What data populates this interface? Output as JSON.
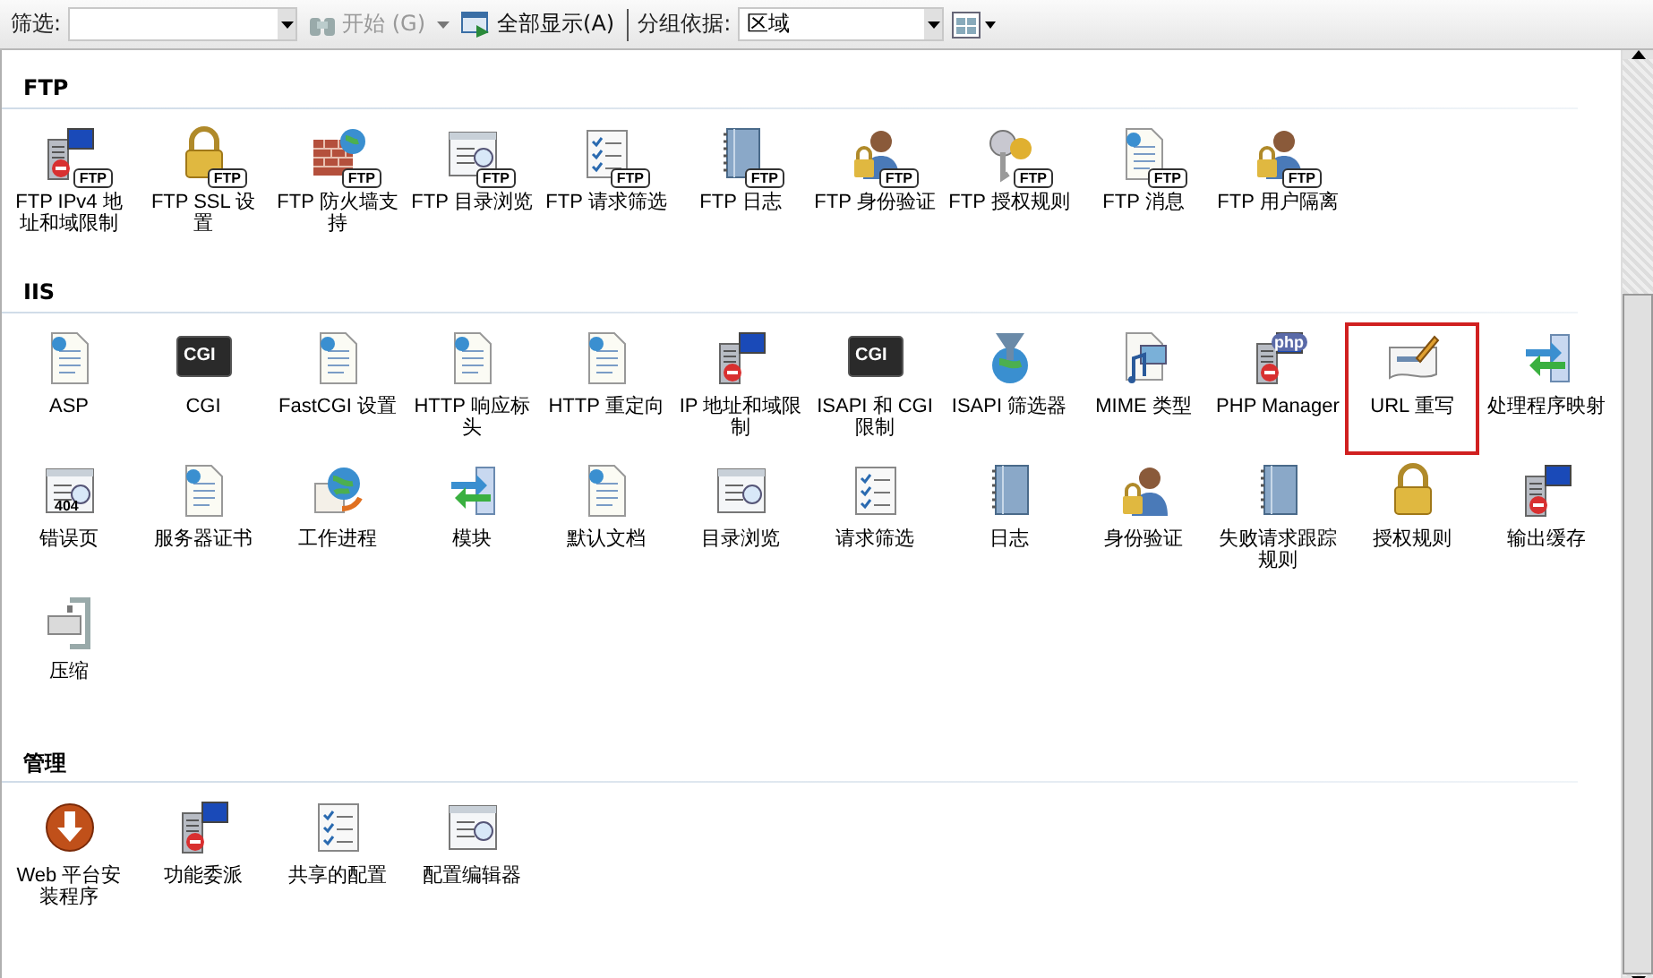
{
  "toolbar": {
    "filter_label": "筛选:",
    "start_button": {
      "label": "开始 (G)",
      "disabled": true
    },
    "show_all_button": {
      "label": "全部显示(A)",
      "disabled": false
    },
    "group_label": "分组依据:",
    "group_value": "区域"
  },
  "sections": [
    {
      "title": "FTP",
      "tiles": [
        {
          "label": "FTP IPv4 地址和域限制",
          "badge": "FTP",
          "selected": false
        },
        {
          "label": "FTP SSL 设置",
          "badge": "FTP",
          "selected": false
        },
        {
          "label": "FTP 防火墙支持",
          "badge": "FTP",
          "selected": false
        },
        {
          "label": "FTP 目录浏览",
          "badge": "FTP",
          "selected": false
        },
        {
          "label": "FTP 请求筛选",
          "badge": "FTP",
          "selected": false
        },
        {
          "label": "FTP 日志",
          "badge": "FTP",
          "selected": false
        },
        {
          "label": "FTP 身份验证",
          "badge": "FTP",
          "selected": false
        },
        {
          "label": "FTP 授权规则",
          "badge": "FTP",
          "selected": false
        },
        {
          "label": "FTP 消息",
          "badge": "FTP",
          "selected": false
        },
        {
          "label": "FTP 用户隔离",
          "badge": "FTP",
          "selected": false
        }
      ]
    },
    {
      "title": "IIS",
      "tiles": [
        {
          "label": "ASP",
          "selected": false
        },
        {
          "label": "CGI",
          "icon_text": "CGI",
          "selected": false
        },
        {
          "label": "FastCGI 设置",
          "selected": false
        },
        {
          "label": "HTTP 响应标头",
          "selected": false
        },
        {
          "label": "HTTP 重定向",
          "selected": false
        },
        {
          "label": "IP 地址和域限制",
          "selected": false
        },
        {
          "label": "ISAPI 和 CGI 限制",
          "icon_text": "CGI",
          "selected": false
        },
        {
          "label": "ISAPI 筛选器",
          "selected": false
        },
        {
          "label": "MIME 类型",
          "selected": false
        },
        {
          "label": "PHP Manager",
          "icon_text": "php",
          "selected": false
        },
        {
          "label": "URL 重写",
          "selected": true
        },
        {
          "label": "处理程序映射",
          "selected": false
        },
        {
          "label": "错误页",
          "icon_text": "404",
          "selected": false
        },
        {
          "label": "服务器证书",
          "selected": false
        },
        {
          "label": "工作进程",
          "selected": false
        },
        {
          "label": "模块",
          "selected": false
        },
        {
          "label": "默认文档",
          "selected": false
        },
        {
          "label": "目录浏览",
          "selected": false
        },
        {
          "label": "请求筛选",
          "selected": false
        },
        {
          "label": "日志",
          "selected": false
        },
        {
          "label": "身份验证",
          "selected": false
        },
        {
          "label": "失败请求跟踪规则",
          "selected": false
        },
        {
          "label": "授权规则",
          "selected": false
        },
        {
          "label": "输出缓存",
          "selected": false
        },
        {
          "label": "压缩",
          "selected": false
        }
      ]
    },
    {
      "title": "管理",
      "tiles": [
        {
          "label": "Web 平台安装程序",
          "selected": false
        },
        {
          "label": "功能委派",
          "selected": false
        },
        {
          "label": "共享的配置",
          "selected": false
        },
        {
          "label": "配置编辑器",
          "selected": false
        }
      ]
    }
  ]
}
